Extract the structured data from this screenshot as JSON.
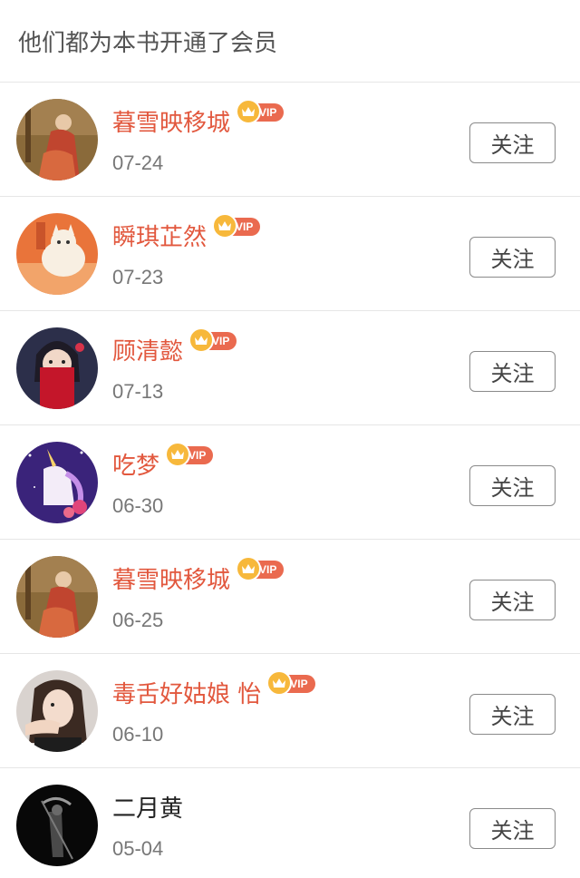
{
  "header": {
    "title": "他们都为本书开通了会员"
  },
  "vip_label": "VIP",
  "follow_label": "关注",
  "members": [
    {
      "name": "暮雪映移城",
      "date": "07-24",
      "vip": true,
      "avatar": "ancient-painting"
    },
    {
      "name": "瞬琪芷然",
      "date": "07-23",
      "vip": true,
      "avatar": "cat-on-orange"
    },
    {
      "name": "顾清懿",
      "date": "07-13",
      "vip": true,
      "avatar": "masked-woman-red"
    },
    {
      "name": "吃梦",
      "date": "06-30",
      "vip": true,
      "avatar": "unicorn-purple"
    },
    {
      "name": "暮雪映移城",
      "date": "06-25",
      "vip": true,
      "avatar": "ancient-painting"
    },
    {
      "name": "毒舌好姑娘 怡",
      "date": "06-10",
      "vip": true,
      "avatar": "girl-photo"
    },
    {
      "name": "二月黄",
      "date": "05-04",
      "vip": false,
      "avatar": "dark-figure"
    }
  ],
  "colors": {
    "vip_name": "#e2583e",
    "vip_pill": "#ea6a4f",
    "crown": "#f7b83b",
    "date": "#777777"
  }
}
